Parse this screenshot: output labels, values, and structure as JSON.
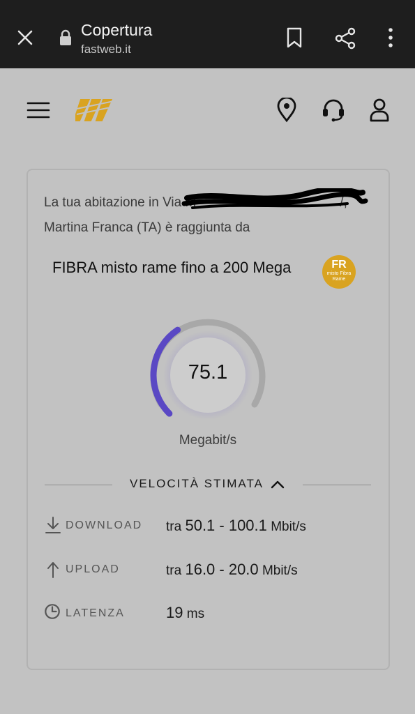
{
  "browser": {
    "title": "Copertura",
    "host": "fastweb.it",
    "icons": [
      "close-icon",
      "lock-icon",
      "bookmark-icon",
      "share-icon",
      "more-icon"
    ]
  },
  "header": {
    "icons": [
      "menu-icon",
      "fastweb-logo",
      "location-pin-icon",
      "headset-icon",
      "user-icon"
    ],
    "brand_color": "#d9a320"
  },
  "coverage": {
    "address_line1": "La tua abitazione in Via M",
    "address_line1_tail": "/,",
    "address_line2": "Martina Franca (TA) è raggiunta da",
    "technology": "FIBRA misto rame fino a 200 Mega",
    "badge_code": "FR",
    "badge_sub": "misto Fibra Rame"
  },
  "gauge": {
    "value": "75.1",
    "unit": "Megabit/s",
    "fraction": 0.375,
    "accent": "#5a48c4"
  },
  "speeds": {
    "section_title": "VELOCITÀ STIMATA",
    "download": {
      "label": "DOWNLOAD",
      "prefix": "tra",
      "range": "50.1 - 100.1",
      "unit": "Mbit/s"
    },
    "upload": {
      "label": "UPLOAD",
      "prefix": "tra",
      "range": "16.0 - 20.0",
      "unit": "Mbit/s"
    },
    "latency": {
      "label": "LATENZA",
      "value": "19",
      "unit": "ms"
    }
  }
}
